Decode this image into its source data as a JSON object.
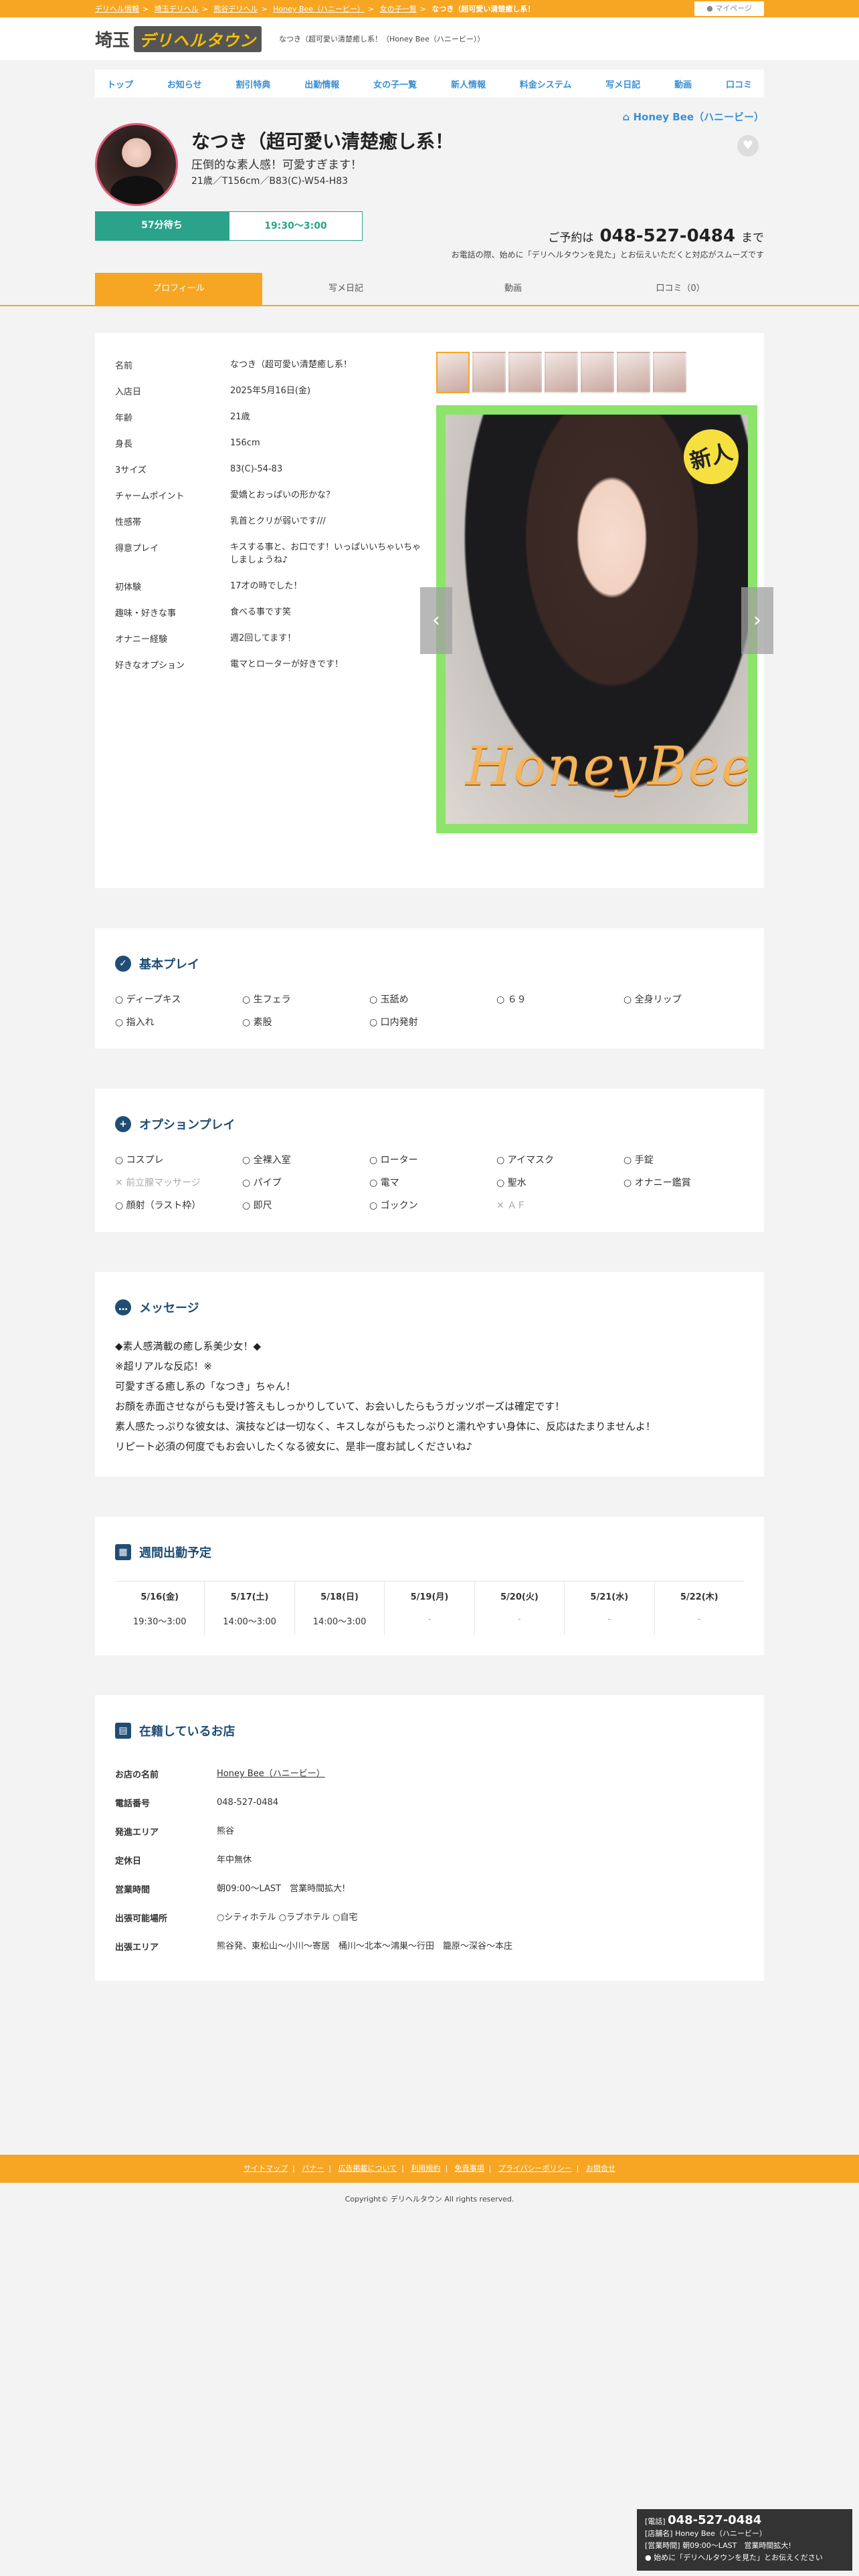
{
  "colors": {
    "accent": "#f6a623",
    "teal": "#2aa38a",
    "navy": "#1f4d74",
    "link": "#3a8fd6"
  },
  "topbar": {
    "crumbs": [
      "デリヘル情報",
      "埼玉デリヘル",
      "熊谷デリヘル",
      "Honey Bee（ハニービー）",
      "女の子一覧",
      "なつき（超可愛い清楚癒し系！"
    ],
    "mypage": "マイページ"
  },
  "header": {
    "logo_prefix": "埼玉",
    "logo_main": "デリヘルタウン",
    "tagline": "なつき（超可愛い清楚癒し系！（Honey Bee（ハニービー））"
  },
  "nav": [
    "トップ",
    "お知らせ",
    "割引特典",
    "出勤情報",
    "女の子一覧",
    "新人情報",
    "料金システム",
    "写メ日記",
    "動画",
    "口コミ"
  ],
  "shop_link": "Honey Bee（ハニービー）",
  "profile": {
    "name": "なつき（超可愛い清楚癒し系！",
    "catch": "圧倒的な素人感！可愛すぎます！",
    "spec": "21歳／T156cm／B83(C)-W54-H83",
    "wait": "57分待ち",
    "hours": "19:30〜3:00"
  },
  "reserve": {
    "label": "ご予約は",
    "tel": "048-527-0484",
    "suffix": "まで",
    "note": "お電話の際、始めに「デリヘルタウンを見た」とお伝えいただくと対応がスムーズです"
  },
  "tabs": [
    "プロフィール",
    "写メ日記",
    "動画",
    "口コミ（0）"
  ],
  "details": [
    {
      "k": "名前",
      "v": "なつき（超可愛い清楚癒し系！"
    },
    {
      "k": "入店日",
      "v": "2025年5月16日(金)"
    },
    {
      "k": "年齢",
      "v": "21歳"
    },
    {
      "k": "身長",
      "v": "156cm"
    },
    {
      "k": "3サイズ",
      "v": "83(C)-54-83"
    },
    {
      "k": "チャームポイント",
      "v": "愛嬌とおっぱいの形かな？"
    },
    {
      "k": "性感帯",
      "v": "乳首とクリが弱いです///"
    },
    {
      "k": "得意プレイ",
      "v": "キスする事と、お口です！いっぱいいちゃいちゃしましょうね♪"
    },
    {
      "k": "初体験",
      "v": "17才の時でした！"
    },
    {
      "k": "趣味・好きな事",
      "v": "食べる事です笑"
    },
    {
      "k": "オナニー経験",
      "v": "週2回してます！"
    },
    {
      "k": "好きなオプション",
      "v": "電マとローターが好きです！"
    }
  ],
  "photo": {
    "new_badge": "新人",
    "brand": "HoneyBee",
    "prev": "‹",
    "next": "›"
  },
  "basic": {
    "title": "基本プレイ",
    "items": [
      {
        "t": "ディープキス",
        "on": true
      },
      {
        "t": "生フェラ",
        "on": true
      },
      {
        "t": "玉舐め",
        "on": true
      },
      {
        "t": "６９",
        "on": true
      },
      {
        "t": "全身リップ",
        "on": true
      },
      {
        "t": "指入れ",
        "on": true
      },
      {
        "t": "素股",
        "on": true
      },
      {
        "t": "口内発射",
        "on": true
      }
    ]
  },
  "option": {
    "title": "オプションプレイ",
    "items": [
      {
        "t": "コスプレ",
        "on": true
      },
      {
        "t": "全裸入室",
        "on": true
      },
      {
        "t": "ローター",
        "on": true
      },
      {
        "t": "アイマスク",
        "on": true
      },
      {
        "t": "手錠",
        "on": true
      },
      {
        "t": "前立腺マッサージ",
        "on": false
      },
      {
        "t": "パイプ",
        "on": true
      },
      {
        "t": "電マ",
        "on": true
      },
      {
        "t": "聖水",
        "on": true
      },
      {
        "t": "オナニー鑑賞",
        "on": true
      },
      {
        "t": "顔射（ラスト枠）",
        "on": true
      },
      {
        "t": "即尺",
        "on": true
      },
      {
        "t": "ゴックン",
        "on": true
      },
      {
        "t": "ＡＦ",
        "on": false
      }
    ]
  },
  "message": {
    "title": "メッセージ",
    "lines": [
      "◆素人感満載の癒し系美少女！◆",
      "※超リアルな反応！※",
      "可愛すぎる癒し系の「なつき」ちゃん！",
      "お顔を赤面させながらも受け答えもしっかりしていて、お会いしたらもうガッツポーズは確定です！",
      "素人感たっぷりな彼女は、演技などは一切なく、キスしながらもたっぷりと濡れやすい身体に、反応はたまりませんよ！",
      "リピート必須の何度でもお会いしたくなる彼女に、是非一度お試しくださいね♪"
    ]
  },
  "schedule": {
    "title": "週間出勤予定",
    "days": [
      {
        "d": "5/16(金)",
        "t": "19:30〜3:00"
      },
      {
        "d": "5/17(土)",
        "t": "14:00〜3:00"
      },
      {
        "d": "5/18(日)",
        "t": "14:00〜3:00"
      },
      {
        "d": "5/19(月)",
        "t": "-"
      },
      {
        "d": "5/20(火)",
        "t": "-"
      },
      {
        "d": "5/21(水)",
        "t": "-"
      },
      {
        "d": "5/22(木)",
        "t": "-"
      }
    ]
  },
  "shop": {
    "title": "在籍しているお店",
    "rows": [
      {
        "k": "お店の名前",
        "v": "Honey Bee（ハニービー）"
      },
      {
        "k": "電話番号",
        "v": "048-527-0484"
      },
      {
        "k": "発進エリア",
        "v": "熊谷"
      },
      {
        "k": "定休日",
        "v": "年中無休"
      },
      {
        "k": "営業時間",
        "v": "朝09:00〜LAST　営業時間拡大!"
      },
      {
        "k": "出張可能場所",
        "v": "○シティホテル ○ラブホテル ○自宅"
      },
      {
        "k": "出張エリア",
        "v": "熊谷発、東松山〜小川〜寄居　桶川〜北本〜鴻巣〜行田　籠原〜深谷〜本庄"
      }
    ]
  },
  "footer": {
    "links": [
      "サイトマップ",
      "バナー",
      "広告掲載について",
      "利用規約",
      "免責事項",
      "プライバシーポリシー",
      "お問合せ"
    ],
    "copyright": "Copyright© デリヘルタウン All rights reserved."
  },
  "fixed": {
    "tel_label": "[電話]",
    "tel": "048-527-0484",
    "shop": "[店舗名] Honey Bee（ハニービー）",
    "hours": "[営業時間] 朝09:00〜LAST　営業時間拡大!",
    "note": "始めに「デリヘルタウンを見た」とお伝えください"
  }
}
